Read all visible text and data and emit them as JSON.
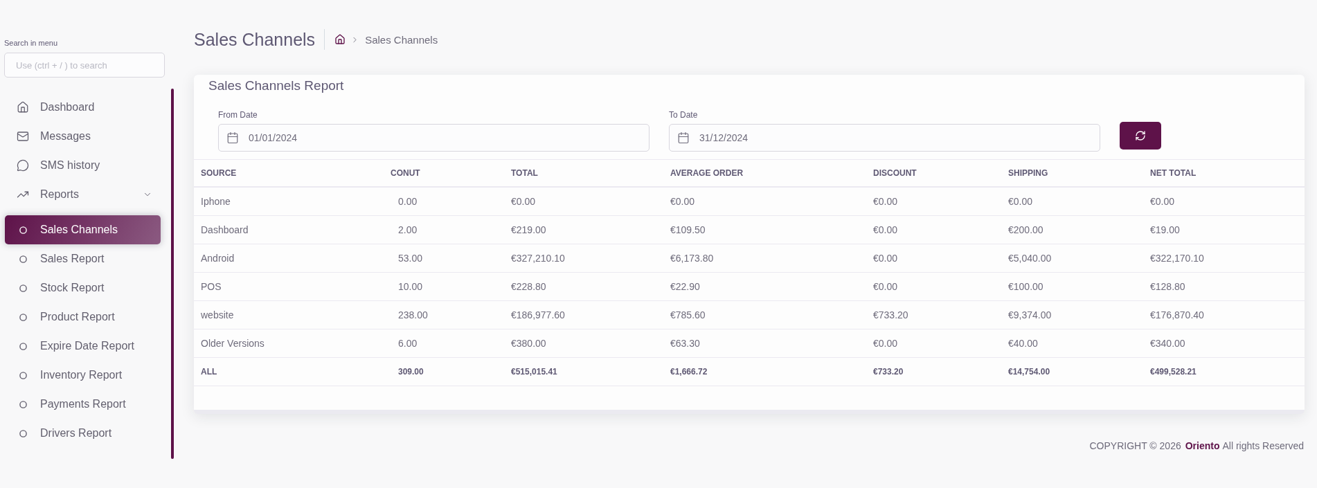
{
  "sidebar": {
    "search": {
      "label": "Search in menu",
      "placeholder": "Use (ctrl + / ) to search"
    },
    "items": [
      {
        "label": "Dashboard",
        "selected": false
      },
      {
        "label": "Messages",
        "selected": false
      },
      {
        "label": "SMS history",
        "selected": false
      },
      {
        "label": "Reports",
        "selected": false,
        "expanded": true,
        "children": [
          {
            "label": "Sales Channels",
            "selected": true
          },
          {
            "label": "Sales Report",
            "selected": false
          },
          {
            "label": "Stock Report",
            "selected": false
          },
          {
            "label": "Product Report",
            "selected": false
          },
          {
            "label": "Expire Date Report",
            "selected": false
          },
          {
            "label": "Inventory Report",
            "selected": false
          },
          {
            "label": "Payments Report",
            "selected": false
          },
          {
            "label": "Drivers Report",
            "selected": false
          }
        ]
      }
    ]
  },
  "header": {
    "title": "Sales Channels",
    "breadcrumb": [
      "Sales Channels"
    ]
  },
  "report": {
    "title": "Sales Channels Report",
    "filters": [
      {
        "label": "From Date",
        "value": "01/01/2024"
      },
      {
        "label": "To Date",
        "value": "31/12/2024"
      }
    ],
    "table": {
      "columns": [
        "SOURCE",
        "CONUT",
        "TOTAL",
        "AVERAGE ORDER",
        "DISCOUNT",
        "SHIPPING",
        "NET TOTAL"
      ],
      "rows": [
        [
          "Iphone",
          "0.00",
          "€0.00",
          "€0.00",
          "€0.00",
          "€0.00",
          "€0.00"
        ],
        [
          "Dashboard",
          "2.00",
          "€219.00",
          "€109.50",
          "€0.00",
          "€200.00",
          "€19.00"
        ],
        [
          "Android",
          "53.00",
          "€327,210.10",
          "€6,173.80",
          "€0.00",
          "€5,040.00",
          "€322,170.10"
        ],
        [
          "POS",
          "10.00",
          "€228.80",
          "€22.90",
          "€0.00",
          "€100.00",
          "€128.80"
        ],
        [
          "website",
          "238.00",
          "€186,977.60",
          "€785.60",
          "€733.20",
          "€9,374.00",
          "€176,870.40"
        ],
        [
          "Older Versions",
          "6.00",
          "€380.00",
          "€63.30",
          "€0.00",
          "€40.00",
          "€340.00"
        ]
      ],
      "total": [
        "ALL",
        "309.00",
        "€515,015.41",
        "€1,666.72",
        "€733.20",
        "€14,754.00",
        "€499,528.21"
      ]
    }
  },
  "footer": {
    "prefix": "COPYRIGHT © 2026",
    "brand": "Oriento",
    "suffix": "All rights Reserved"
  }
}
